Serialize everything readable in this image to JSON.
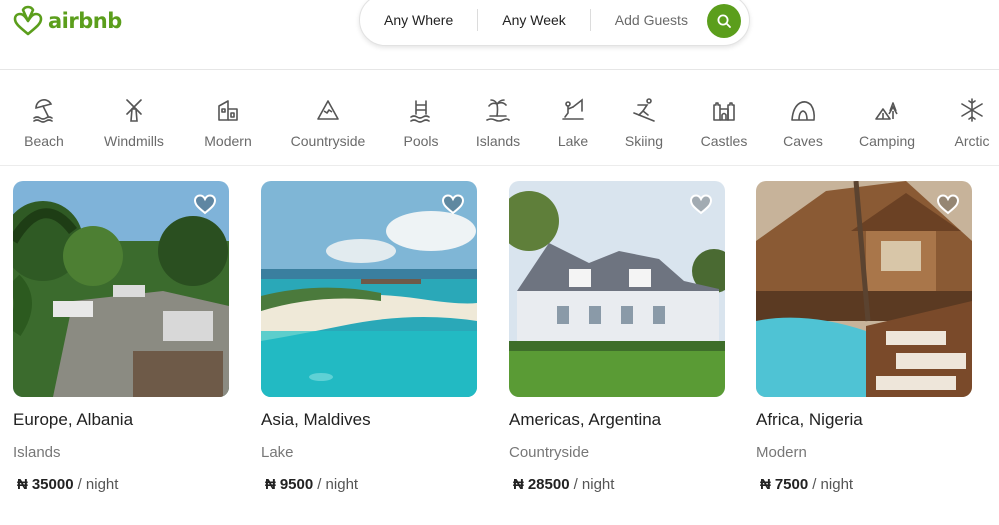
{
  "brand": {
    "name": "airbnb",
    "color": "#5b9e1c"
  },
  "search": {
    "where": "Any Where",
    "week": "Any Week",
    "guests": "Add Guests",
    "button_icon": "search-icon"
  },
  "categories": [
    {
      "label": "Beach",
      "icon": "beach-umbrella-icon"
    },
    {
      "label": "Windmills",
      "icon": "windmill-icon"
    },
    {
      "label": "Modern",
      "icon": "modern-house-icon"
    },
    {
      "label": "Countryside",
      "icon": "mountain-icon"
    },
    {
      "label": "Pools",
      "icon": "pool-icon"
    },
    {
      "label": "Islands",
      "icon": "palm-island-icon"
    },
    {
      "label": "Lake",
      "icon": "lake-fishing-icon"
    },
    {
      "label": "Skiing",
      "icon": "skier-icon"
    },
    {
      "label": "Castles",
      "icon": "castle-icon"
    },
    {
      "label": "Caves",
      "icon": "cave-icon"
    },
    {
      "label": "Camping",
      "icon": "camping-tent-icon"
    },
    {
      "label": "Arctic",
      "icon": "snowflake-icon"
    }
  ],
  "listings": [
    {
      "title": "Europe, Albania",
      "category": "Islands",
      "currency": "₦",
      "price": "35000",
      "unit": "/ night"
    },
    {
      "title": "Asia, Maldives",
      "category": "Lake",
      "currency": "₦",
      "price": "9500",
      "unit": "/ night"
    },
    {
      "title": "Americas, Argentina",
      "category": "Countryside",
      "currency": "₦",
      "price": "28500",
      "unit": "/ night"
    },
    {
      "title": "Africa, Nigeria",
      "category": "Modern",
      "currency": "₦",
      "price": "7500",
      "unit": "/ night"
    }
  ]
}
